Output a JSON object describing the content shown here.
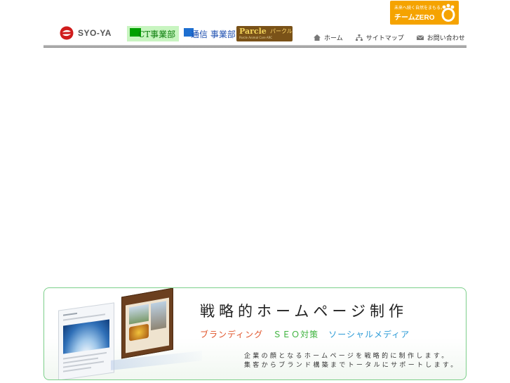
{
  "team_banner": {
    "tagline": "未来へ続く自然をまもる。",
    "name": "チームZERO"
  },
  "logos": {
    "syoya": "SYO-YA",
    "ict": "CT事業部",
    "tsushin": "通信 事業部",
    "parcle_main": "Parcle",
    "parcle_kana": "パークル",
    "parcle_sub": "Parcle Animal Care ARC"
  },
  "nav": {
    "items": [
      {
        "icon": "home-icon",
        "label": "ホーム"
      },
      {
        "icon": "sitemap-icon",
        "label": "サイトマップ"
      },
      {
        "icon": "mail-icon",
        "label": "お問い合わせ"
      }
    ]
  },
  "promo": {
    "title": "戦略的ホームページ制作",
    "tags": [
      "ブランディング",
      "ＳＥＯ対策",
      "ソーシャルメディア"
    ],
    "desc_line1": "企業の顔となるホームページを戦略的に制作します。",
    "desc_line2": "集客からブランド構築までトータルにサポートします。"
  },
  "colors": {
    "team_orange": "#f5a300",
    "ict_green": "#00a000",
    "tsushin_blue": "#1e6fd0",
    "parcle_brown": "#7a5218",
    "promo_border": "#7ccf8a",
    "tag_orange": "#e0542a",
    "tag_green": "#3db33d",
    "tag_blue": "#2a9ad6"
  }
}
